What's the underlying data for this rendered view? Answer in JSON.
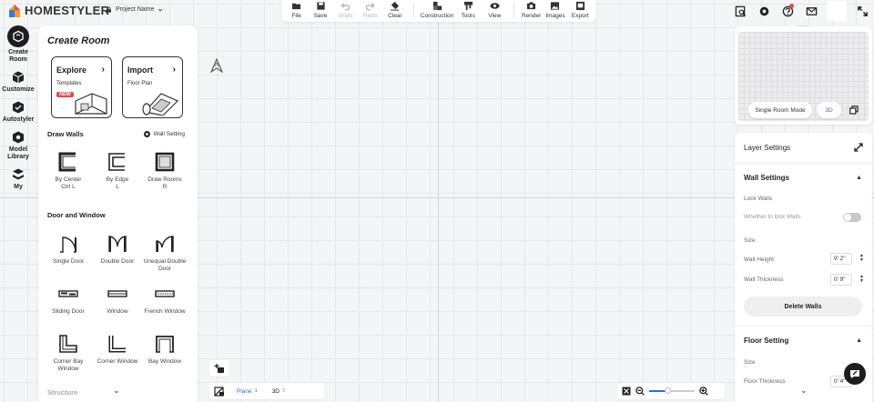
{
  "app": {
    "brand": "HOMESTYLER",
    "project_name": "Project Name"
  },
  "toolbar": {
    "items": [
      {
        "label": "File",
        "icon": "folder-icon",
        "enabled": true
      },
      {
        "label": "Save",
        "icon": "save-icon",
        "enabled": true
      },
      {
        "label": "Undo",
        "icon": "undo-icon",
        "enabled": false
      },
      {
        "label": "Redo",
        "icon": "redo-icon",
        "enabled": false
      },
      {
        "label": "Clear",
        "icon": "eraser-icon",
        "enabled": true
      },
      {
        "label": "Construction",
        "icon": "construction-icon",
        "enabled": true
      },
      {
        "label": "Tools",
        "icon": "tools-icon",
        "enabled": true
      },
      {
        "label": "View",
        "icon": "eye-icon",
        "enabled": true
      },
      {
        "label": "Render",
        "icon": "camera-icon",
        "enabled": true
      },
      {
        "label": "Images",
        "icon": "image-icon",
        "enabled": true
      },
      {
        "label": "Export",
        "icon": "export-icon",
        "enabled": true
      }
    ]
  },
  "top_right_icons": [
    "search-doc-icon",
    "settings-icon",
    "help-icon",
    "mail-icon",
    "fullscreen-icon"
  ],
  "rail": {
    "items": [
      {
        "label": "Create Room",
        "icon": "create-room-icon",
        "active": true
      },
      {
        "label": "Customize",
        "icon": "customize-cube-icon",
        "active": false
      },
      {
        "label": "Autostyler",
        "icon": "autostyler-icon",
        "active": false
      },
      {
        "label": "Model Library",
        "icon": "model-library-icon",
        "active": false
      },
      {
        "label": "My",
        "icon": "my-stack-icon",
        "active": false
      }
    ]
  },
  "create_room": {
    "title": "Create Room",
    "explore": {
      "title": "Explore",
      "sub": "Templates",
      "badge": "NEW"
    },
    "import": {
      "title": "Import",
      "sub": "Floor Plan"
    },
    "draw_walls": {
      "label": "Draw Walls",
      "setting": "Wall Setting",
      "tools": [
        {
          "name": "By Center",
          "shortcut": "Ctrl L"
        },
        {
          "name": "By Edge",
          "shortcut": "L"
        },
        {
          "name": "Draw Rooms",
          "shortcut": "R"
        }
      ]
    },
    "door_window": {
      "label": "Door and Window",
      "tools": [
        "Single Door",
        "Double Door",
        "Unequal Double Door",
        "Sliding Door",
        "Window",
        "French Window",
        "Corner Bay Window",
        "Corner Window",
        "Bay Window"
      ]
    },
    "structure_label": "Structure"
  },
  "canvas": {
    "planes": [
      {
        "label": "Plane",
        "count": "1",
        "active": true
      },
      {
        "label": "3D",
        "count": "3",
        "active": false
      }
    ],
    "zoom_fraction": 0.4
  },
  "preview": {
    "mode_label": "Single Room Mode",
    "view_label": "3D"
  },
  "layer_settings": {
    "title": "Layer Settings",
    "wall_settings": {
      "title": "Wall Settings",
      "lock_walls_label": "Lock Walls",
      "lock_walls_desc": "Whether to lock Walls",
      "lock_walls_on": false,
      "size_label": "Size",
      "wall_height_label": "Wall Height",
      "wall_height": "9' 2\"",
      "wall_thickness_label": "Wall Thickness",
      "wall_thickness": "0' 9\"",
      "delete_label": "Delete Walls"
    },
    "floor_setting": {
      "title": "Floor Setting",
      "size_label": "Size",
      "floor_thickness_label": "Floor Thickness",
      "floor_thickness": "0' 4\""
    }
  }
}
